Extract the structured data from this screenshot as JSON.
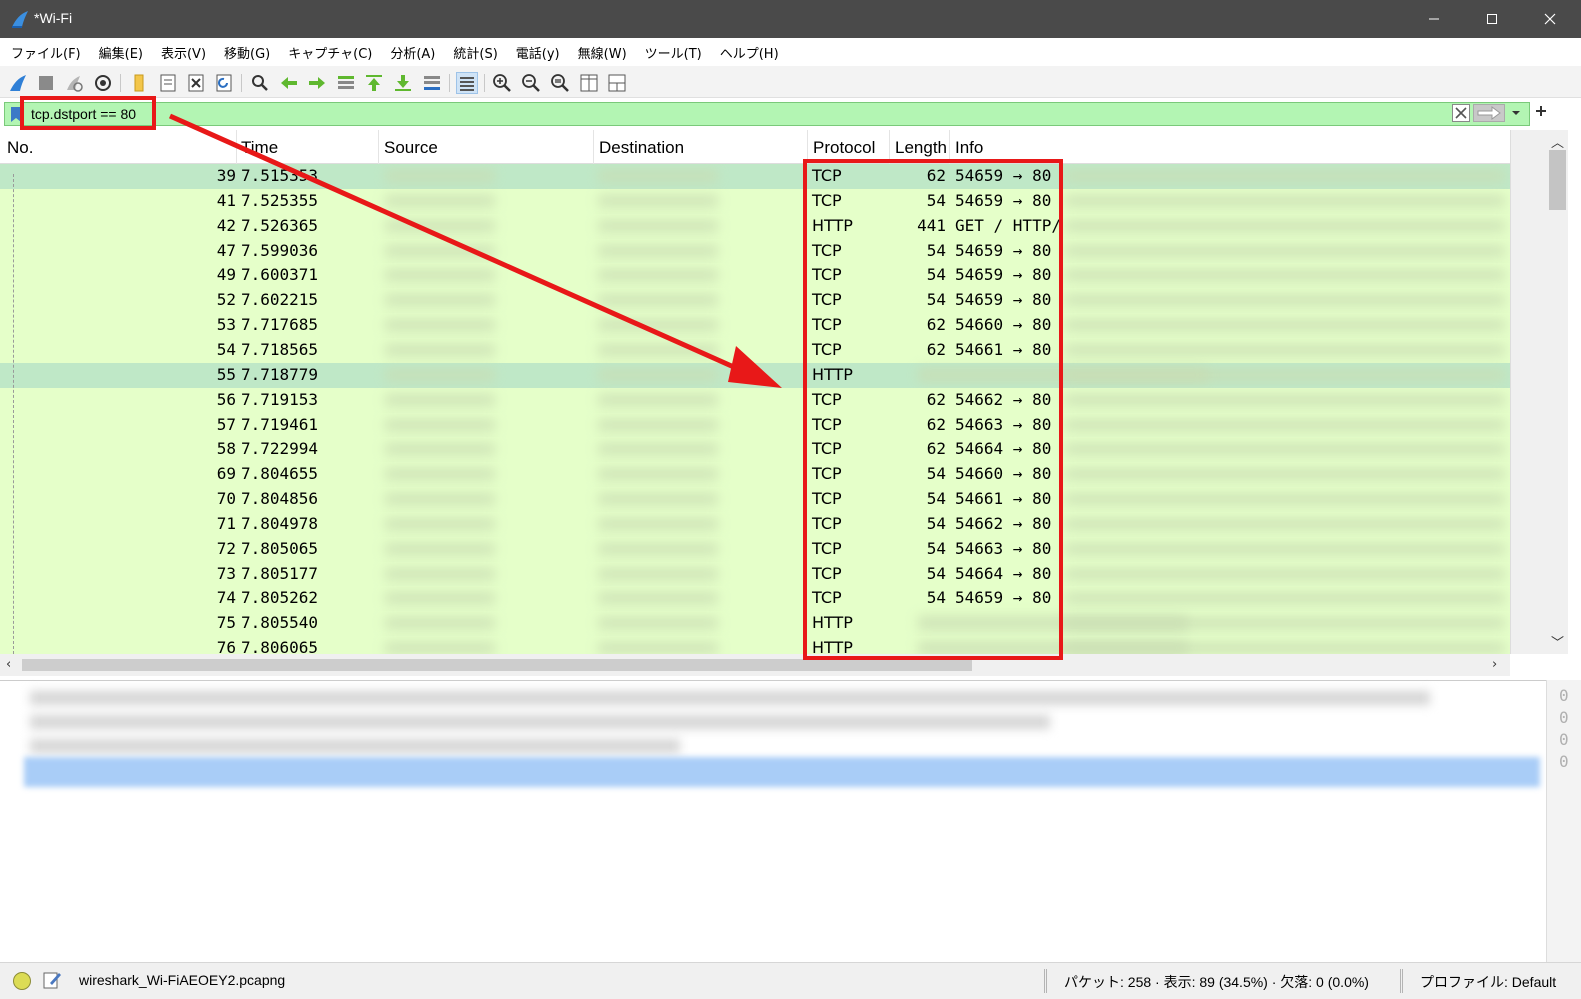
{
  "window": {
    "title": "*Wi-Fi"
  },
  "menu": [
    "ファイル(F)",
    "編集(E)",
    "表示(V)",
    "移動(G)",
    "キャプチャ(C)",
    "分析(A)",
    "統計(S)",
    "電話(y)",
    "無線(W)",
    "ツール(T)",
    "ヘルプ(H)"
  ],
  "filter": {
    "value": "tcp.dstport == 80"
  },
  "columns": {
    "no": "No.",
    "time": "Time",
    "source": "Source",
    "destination": "Destination",
    "protocol": "Protocol",
    "length": "Length",
    "info": "Info"
  },
  "packets": [
    {
      "no": "39",
      "time": "7.515353",
      "protocol": "TCP",
      "length": "62",
      "info": "54659 → 80"
    },
    {
      "no": "41",
      "time": "7.525355",
      "protocol": "TCP",
      "length": "54",
      "info": "54659 → 80"
    },
    {
      "no": "42",
      "time": "7.526365",
      "protocol": "HTTP",
      "length": "441",
      "info": "GET / HTTP/"
    },
    {
      "no": "47",
      "time": "7.599036",
      "protocol": "TCP",
      "length": "54",
      "info": "54659 → 80"
    },
    {
      "no": "49",
      "time": "7.600371",
      "protocol": "TCP",
      "length": "54",
      "info": "54659 → 80"
    },
    {
      "no": "52",
      "time": "7.602215",
      "protocol": "TCP",
      "length": "54",
      "info": "54659 → 80"
    },
    {
      "no": "53",
      "time": "7.717685",
      "protocol": "TCP",
      "length": "62",
      "info": "54660 → 80"
    },
    {
      "no": "54",
      "time": "7.718565",
      "protocol": "TCP",
      "length": "62",
      "info": "54661 → 80"
    },
    {
      "no": "55",
      "time": "7.718779",
      "protocol": "HTTP",
      "length": "",
      "info": ""
    },
    {
      "no": "56",
      "time": "7.719153",
      "protocol": "TCP",
      "length": "62",
      "info": "54662 → 80"
    },
    {
      "no": "57",
      "time": "7.719461",
      "protocol": "TCP",
      "length": "62",
      "info": "54663 → 80"
    },
    {
      "no": "58",
      "time": "7.722994",
      "protocol": "TCP",
      "length": "62",
      "info": "54664 → 80"
    },
    {
      "no": "69",
      "time": "7.804655",
      "protocol": "TCP",
      "length": "54",
      "info": "54660 → 80"
    },
    {
      "no": "70",
      "time": "7.804856",
      "protocol": "TCP",
      "length": "54",
      "info": "54661 → 80"
    },
    {
      "no": "71",
      "time": "7.804978",
      "protocol": "TCP",
      "length": "54",
      "info": "54662 → 80"
    },
    {
      "no": "72",
      "time": "7.805065",
      "protocol": "TCP",
      "length": "54",
      "info": "54663 → 80"
    },
    {
      "no": "73",
      "time": "7.805177",
      "protocol": "TCP",
      "length": "54",
      "info": "54664 → 80"
    },
    {
      "no": "74",
      "time": "7.805262",
      "protocol": "TCP",
      "length": "54",
      "info": "54659 → 80"
    },
    {
      "no": "75",
      "time": "7.805540",
      "protocol": "HTTP",
      "length": "",
      "info": ""
    },
    {
      "no": "76",
      "time": "7.806065",
      "protocol": "HTTP",
      "length": "",
      "info": ""
    }
  ],
  "status": {
    "file": "wireshark_Wi-FiAEOEY2.pcapng",
    "packets": "パケット: 258 · 表示: 89 (34.5%) · 欠落: 0 (0.0%)",
    "profile": "プロファイル: Default"
  },
  "bytes_digit": "0",
  "colors": {
    "row_bg": "#e5ffc9",
    "row_selected": "#bfe8c7",
    "filter_bg": "#b3f5b3",
    "highlight": "#e81818",
    "titlebar": "#4a4a4a"
  },
  "icons": [
    "shark-fin-icon",
    "stop-icon",
    "restart-icon",
    "options-gear-icon",
    "open-folder-icon",
    "save-file-icon",
    "close-file-icon",
    "reload-icon",
    "find-icon",
    "back-arrow-icon",
    "forward-arrow-icon",
    "goto-packet-icon",
    "first-packet-icon",
    "last-packet-icon",
    "autoscroll-icon",
    "colorize-icon",
    "zoom-in-icon",
    "zoom-out-icon",
    "zoom-reset-icon",
    "resize-columns-icon",
    "layout-icon"
  ]
}
